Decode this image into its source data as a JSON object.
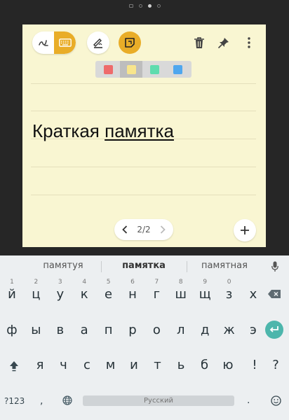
{
  "note": {
    "title_plain": "Краткая",
    "title_underlined": "памятка",
    "background_color": "#f9f6d2"
  },
  "toolbar": {
    "mode_icons": [
      "pen-mode-icon",
      "keyboard-mode-icon"
    ],
    "active_mode": "keyboard",
    "style_icon": "pen-style-icon",
    "color_icon": "note-color-icon",
    "delete_icon": "trash-icon",
    "pin_icon": "pin-icon",
    "menu_icon": "more-vert-icon",
    "accent_color": "#e9ad28"
  },
  "palette": {
    "colors": [
      "#ee6b6b",
      "#f8e58c",
      "#5fdcae",
      "#4fa7ee"
    ],
    "selected_index": 1
  },
  "pager": {
    "label": "2/2"
  },
  "keyboard": {
    "suggestions": [
      "памятуя",
      "памятка",
      "памятная"
    ],
    "primary_suggestion_index": 1,
    "row1": [
      "й",
      "ц",
      "у",
      "к",
      "е",
      "н",
      "г",
      "ш",
      "щ",
      "з",
      "х"
    ],
    "row1_hints": [
      "1",
      "2",
      "3",
      "4",
      "5",
      "6",
      "7",
      "8",
      "9",
      "0",
      ""
    ],
    "row2": [
      "ф",
      "ы",
      "в",
      "а",
      "п",
      "р",
      "о",
      "л",
      "д",
      "ж",
      "э"
    ],
    "row3": [
      "я",
      "ч",
      "с",
      "м",
      "и",
      "т",
      "ь",
      "б",
      "ю"
    ],
    "extra_keys": [
      "!",
      "?"
    ],
    "symbols_key": "?123",
    "comma_key": ",",
    "period_key": ".",
    "space_label": "Русский",
    "enter_color": "#4db6ac"
  }
}
